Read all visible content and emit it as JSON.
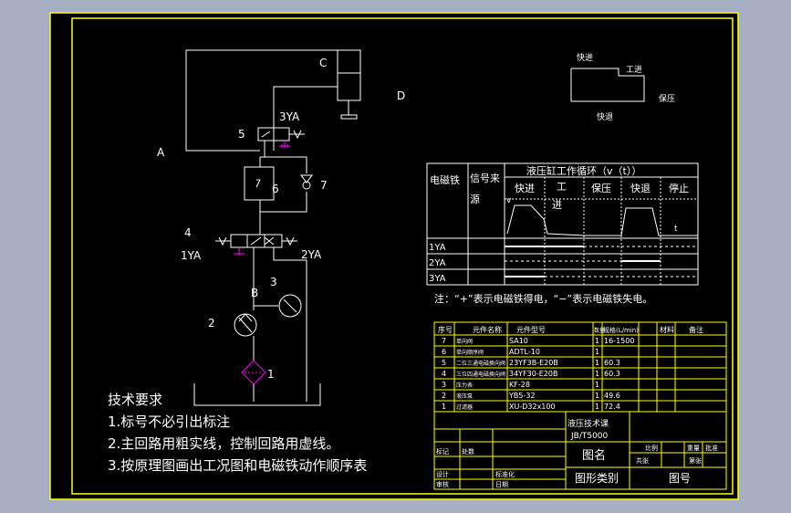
{
  "labels": {
    "A": "A",
    "B": "B",
    "C": "C",
    "D": "D",
    "n1": "1",
    "n2": "2",
    "n3": "3",
    "n4": "4",
    "n5": "5",
    "n6": "6",
    "n7": "7",
    "yv1": "1YA",
    "yv2": "2YA",
    "yv3": "3YA"
  },
  "cycle_sketch": {
    "fast_forward": "快进",
    "work_feed": "工进",
    "fast_return": "快退",
    "hold": "保压"
  },
  "action_table": {
    "col_solenoid": "电磁铁",
    "col_signal_l1": "信号来",
    "col_signal_l2": "源",
    "cycle_title": "液压缸工作循环（v（t））",
    "phases": [
      "快进",
      "工",
      "进",
      "保压",
      "快退",
      "停止"
    ],
    "axis_v": "v",
    "axis_t": "t",
    "rows": [
      "1YA",
      "2YA",
      "3YA"
    ],
    "note": "注：“+”表示电磁铁得电，“−”表示电磁铁失电。"
  },
  "parts_list": {
    "rows": [
      {
        "no": "7",
        "name": "单向阀",
        "model": "SA10",
        "qty": "1",
        "spec": "16-1500"
      },
      {
        "no": "6",
        "name": "单向顺序阀",
        "model": "ADTL-10",
        "qty": "1",
        "spec": ""
      },
      {
        "no": "5",
        "name": "二位三通电磁换向阀",
        "model": "23YF3B-E20B",
        "qty": "1",
        "spec": "60.3"
      },
      {
        "no": "4",
        "name": "三位四通电磁换向阀",
        "model": "34YF30-E20B",
        "qty": "1",
        "spec": "60.3"
      },
      {
        "no": "3",
        "name": "压力表",
        "model": "KF-28",
        "qty": "1",
        "spec": ""
      },
      {
        "no": "2",
        "name": "液压泵",
        "model": "YB5-32",
        "qty": "1",
        "spec": "49.6"
      },
      {
        "no": "1",
        "name": "过滤器",
        "model": "XU-D32x100",
        "qty": "1",
        "spec": "72.4"
      }
    ],
    "header": {
      "no": "序号",
      "name": "元件名称",
      "model": "元件型号",
      "qty": "数量",
      "spec": "规格(L/min)",
      "c6": "材料",
      "c7": "备注",
      "note": "备注"
    },
    "std_text": "液压技术课",
    "std_code": "JB/T5000",
    "drawing_name": "图名",
    "drawing_type": "图形类别",
    "drawing_no": "图号",
    "cell_a": "标记",
    "cell_b": "处数",
    "cell_c": "设计",
    "cell_d": "审核",
    "cell_e": "标准化",
    "cell_f": "比例",
    "cell_g": "重量",
    "cell_h": "共张",
    "cell_i": "第张",
    "cell_j": "日期",
    "cell_k": "批准"
  },
  "requirements": {
    "title": "技术要求",
    "items": [
      "1.标号不必引出标注",
      "2.主回路用粗实线，控制回路用虚线。",
      "3.按原理图画出工况图和电磁铁动作顺序表"
    ]
  },
  "colors": {
    "background": "#a7afc2",
    "paper": "#000000",
    "line": "#ffffff",
    "frame": "#ffff00",
    "magenta": "#ff00ff"
  }
}
